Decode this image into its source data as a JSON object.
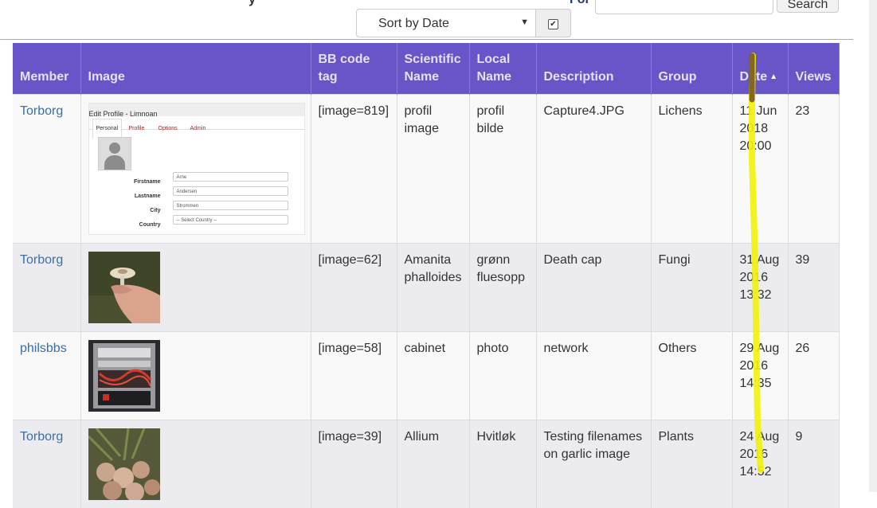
{
  "toolbar": {
    "sort_select_value": "Sort by Date",
    "sort_direction_checked": "✔",
    "for_label": "For",
    "search_button_label": "Search",
    "cut_text": "y"
  },
  "table": {
    "headers": {
      "member": "Member",
      "image": "Image",
      "bbcode": "BB code tag",
      "scientific": "Scientific Name",
      "local": "Local Name",
      "description": "Description",
      "group": "Group",
      "date": "Date",
      "views": "Views"
    },
    "rows": [
      {
        "member": "Torborg",
        "image_icon": "profile-screenshot",
        "bbcode": "[image=819]",
        "scientific": "profil image",
        "local": "profil bilde",
        "description": "Capture4.JPG",
        "group": "Lichens",
        "date": "11 Jun 2018 20:00",
        "views": "23"
      },
      {
        "member": "Torborg",
        "image_icon": "mushroom-photo",
        "bbcode": "[image=62]",
        "scientific": "Amanita phalloides",
        "local": "grønn fluesopp",
        "description": "Death cap",
        "group": "Fungi",
        "date": "31 Aug 2016 13:32",
        "views": "39"
      },
      {
        "member": "philsbbs",
        "image_icon": "network-cabinet-photo",
        "bbcode": "[image=58]",
        "scientific": "cabinet",
        "local": "photo",
        "description": "network",
        "group": "Others",
        "date": "29 Aug 2016 14:35",
        "views": "26"
      },
      {
        "member": "Torborg",
        "image_icon": "garlic-photo",
        "bbcode": "[image=39]",
        "scientific": "Allium",
        "local": "Hvitløk",
        "description": "Testing filenames on garlic image",
        "group": "Plants",
        "date": "24 Aug 2016 14:52",
        "views": "9"
      }
    ]
  },
  "profile_thumb": {
    "title": "Edit Profile - Limnoan",
    "tabs": [
      "Personal",
      "Profile",
      "Options",
      "Admin"
    ],
    "fields": [
      {
        "label": "Firstname",
        "value": "Arne"
      },
      {
        "label": "Lastname",
        "value": "Andersen"
      },
      {
        "label": "City",
        "value": "Strommen"
      },
      {
        "label": "Country",
        "value": "-- Select Country --"
      }
    ]
  },
  "colors": {
    "header_bg": "#6a55c8",
    "link": "#3a6fa8",
    "highlighter": "#f2f20a"
  }
}
